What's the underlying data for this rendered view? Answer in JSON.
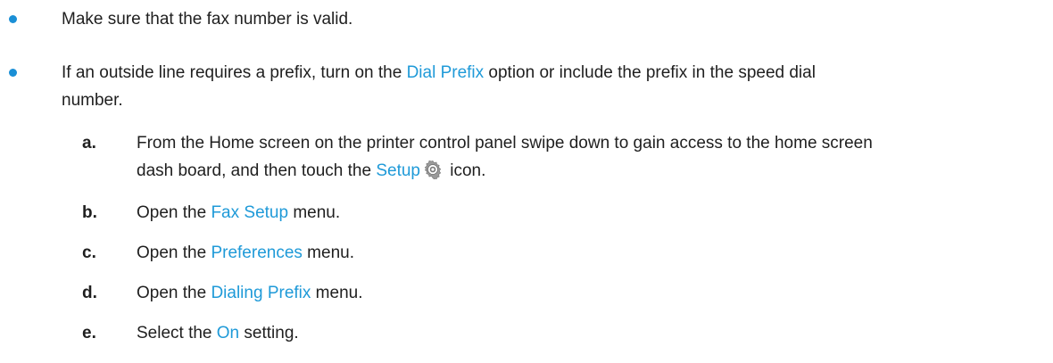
{
  "colors": {
    "accent": "#1f9ad8",
    "text": "#1f1f1f"
  },
  "bullets": [
    {
      "text": "Make sure that the fax number is valid."
    },
    {
      "pre": "If an outside line requires a prefix, turn on the ",
      "link": "Dial Prefix",
      "post_line1": " option or include the prefix in the speed dial",
      "line2": "number."
    }
  ],
  "steps": [
    {
      "letter": "a.",
      "line1": "From the Home screen on the printer control panel swipe down to gain access to the home screen",
      "line2_pre": "dash board, and then touch the ",
      "link": "Setup",
      "icon": "gear-icon",
      "line2_post": " icon."
    },
    {
      "letter": "b.",
      "pre": "Open the ",
      "link": "Fax Setup",
      "post": " menu."
    },
    {
      "letter": "c.",
      "pre": "Open the ",
      "link": "Preferences",
      "post": " menu."
    },
    {
      "letter": "d.",
      "pre": "Open the ",
      "link": "Dialing Prefix",
      "post": " menu."
    },
    {
      "letter": "e.",
      "pre": "Select the ",
      "link": "On",
      "post": " setting."
    }
  ]
}
